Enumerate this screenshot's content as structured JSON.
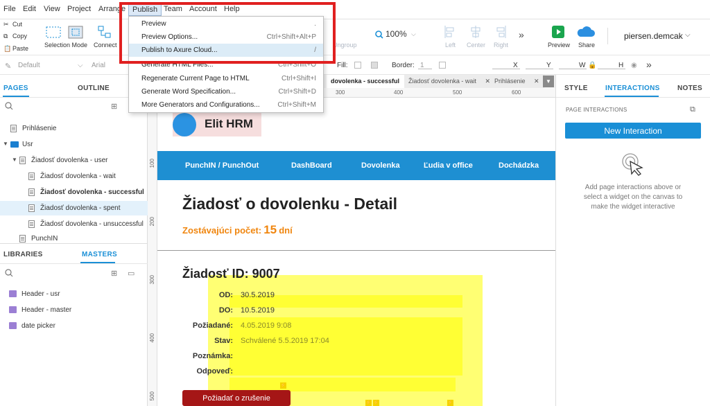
{
  "menubar": {
    "items": [
      "File",
      "Edit",
      "View",
      "Project",
      "Arrange",
      "Publish",
      "Team",
      "Account",
      "Help"
    ]
  },
  "toolbar": {
    "cut": "Cut",
    "copy": "Copy",
    "paste": "Paste",
    "selection_mode": "Selection Mode",
    "connect": "Connect",
    "ungroup": "Ungroup",
    "zoom": "100%",
    "left": "Left",
    "center": "Center",
    "right": "Right",
    "preview": "Preview",
    "share": "Share",
    "user": "piersen.demcak"
  },
  "stylebar": {
    "style": "Default",
    "font": "Arial",
    "fill": "Fill:",
    "border": "Border:",
    "border_width": "1",
    "x": "X",
    "y": "Y",
    "w": "W",
    "h": "H"
  },
  "left_panel": {
    "tabs": [
      "PAGES",
      "OUTLINE"
    ],
    "pages": [
      "Prihlásenie",
      "Usr",
      "Žiadosť dovolenka - user",
      "Žiadosť dovolenka - wait",
      "Žiadosť dovolenka - successful",
      "Žiadosť dovolenka - spent",
      "Žiadosť dovolenka - unsuccessful",
      "PunchIN"
    ],
    "lib_tabs": [
      "LIBRARIES",
      "MASTERS"
    ],
    "masters": [
      "Header - usr",
      "Header - master",
      "date picker"
    ]
  },
  "canvas_tabs": [
    "dovolenka - successful",
    "Žiadosť dovolenka - wait",
    "Prihlásenie"
  ],
  "ruler": {
    "top": [
      "300",
      "400",
      "500",
      "600"
    ],
    "left": [
      "100",
      "200",
      "300",
      "400",
      "500"
    ]
  },
  "page_design": {
    "logo_text": "Elit HRM",
    "nav": [
      "PunchIN / PunchOut",
      "DashBoard",
      "Dovolenka",
      "Ľudia v office",
      "Dochádzka"
    ],
    "title": "Žiadosť o dovolenku - Detail",
    "remaining_label": "Zostávajúci počet:",
    "remaining_value": "15",
    "remaining_unit": "dní",
    "request_id": "Žiadosť ID: 9007",
    "fields": [
      {
        "label": "OD:",
        "value": "30.5.2019"
      },
      {
        "label": "DO:",
        "value": "10.5.2019"
      },
      {
        "label": "Požiadané:",
        "value": "4.05.2019 9:08"
      },
      {
        "label": "Stav:",
        "value": "Schválené 5.5.2019 17:04"
      },
      {
        "label": "Poznámka:",
        "value": ""
      },
      {
        "label": "Odpoveď:",
        "value": ""
      }
    ],
    "cancel_button": "Požiadať o zrušenie"
  },
  "right_panel": {
    "tabs": [
      "STYLE",
      "INTERACTIONS",
      "NOTES"
    ],
    "section": "PAGE INTERACTIONS",
    "new_interaction": "New Interaction",
    "hint": "Add page interactions above or select a widget on the canvas to make the widget interactive"
  },
  "publish_menu": {
    "items": [
      {
        "label": "Preview",
        "shortcut": "."
      },
      {
        "label": "Preview Options...",
        "shortcut": "Ctrl+Shift+Alt+P"
      },
      {
        "label": "Publish to Axure Cloud...",
        "shortcut": "/"
      },
      {
        "label": "Generate HTML Files...",
        "shortcut": "Ctrl+Shift+O"
      },
      {
        "label": "Regenerate Current Page to HTML",
        "shortcut": "Ctrl+Shift+I"
      },
      {
        "label": "Generate Word Specification...",
        "shortcut": "Ctrl+Shift+D"
      },
      {
        "label": "More Generators and Configurations...",
        "shortcut": "Ctrl+Shift+M"
      }
    ]
  },
  "colors": {
    "accent": "#1a8fd6",
    "nav_bar": "#1e8fd2",
    "orange": "#f0860f",
    "cancel_btn": "#a51616",
    "highlight": "#e02020"
  }
}
